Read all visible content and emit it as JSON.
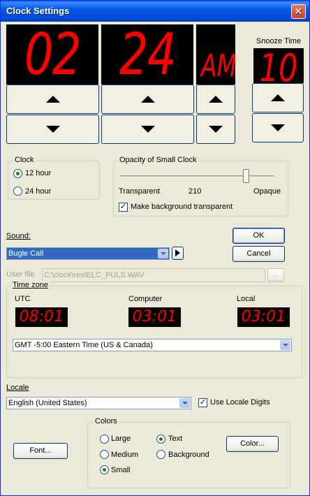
{
  "window": {
    "title": "Clock Settings",
    "close_glyph": "✕"
  },
  "clock": {
    "hour": "02",
    "minute": "24",
    "ampm": "AM"
  },
  "snooze": {
    "label": "Snooze Time",
    "value": "10"
  },
  "clock_group": {
    "title": "Clock",
    "option_12": "12 hour",
    "option_24": "24 hour",
    "selected": "12 hour"
  },
  "opacity_group": {
    "title": "Opacity of Small Clock",
    "label_min": "Transparent",
    "value": "210",
    "label_max": "Opaque",
    "slider_fraction": 0.82,
    "checkbox_label": "Make background transparent",
    "checkbox_checked": true
  },
  "sound": {
    "label": "Sound:",
    "selected": "Bugle Call"
  },
  "buttons": {
    "ok": "OK",
    "cancel": "Cancel",
    "font": "Font...",
    "color": "Color...",
    "browse": "..."
  },
  "user_file": {
    "label": "User file",
    "path": "C:\\clock\\res\\ELC_PULS.WAV"
  },
  "timezone": {
    "title": "Time zone",
    "utc_label": "UTC",
    "computer_label": "Computer",
    "local_label": "Local",
    "utc_time": "08:01",
    "computer_time": "03:01",
    "local_time": "03:01",
    "selected": "GMT -5:00 Eastern Time (US & Canada)"
  },
  "locale": {
    "label": "Locale",
    "selected": "English (United States)",
    "use_digits_label": "Use Locale Digits",
    "use_digits_checked": true
  },
  "colors": {
    "title": "Colors",
    "large": "Large",
    "medium": "Medium",
    "small": "Small",
    "text": "Text",
    "background": "Background",
    "size_selected": "Small",
    "target_selected": "Text"
  },
  "theme": {
    "led_color": "#FF0000",
    "title_blue": "#0054E3",
    "face": "#ECE9D8"
  }
}
